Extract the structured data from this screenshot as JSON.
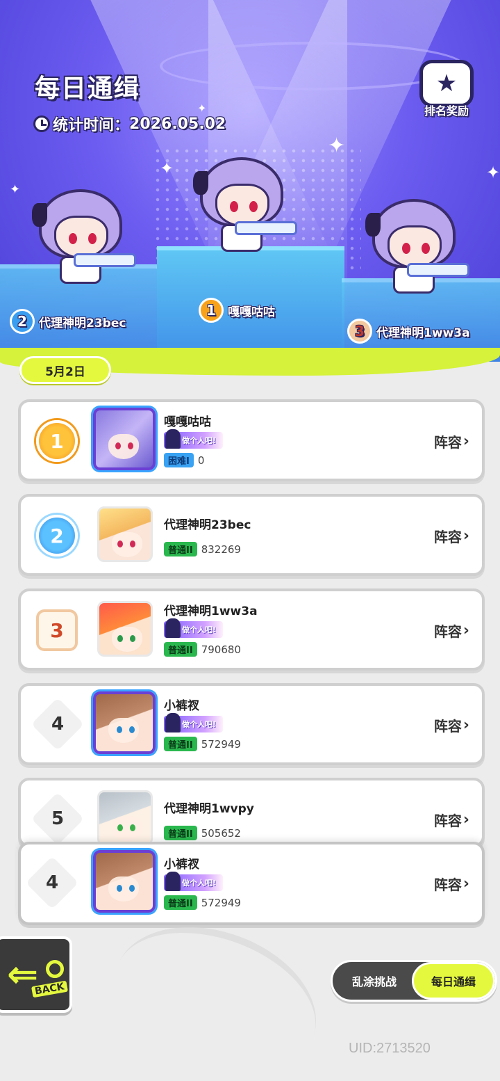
{
  "header": {
    "title": "每日通缉",
    "stat_time_label": "统计时间：",
    "stat_time_value": "2026.05.02",
    "reward_label": "排名奖励"
  },
  "podium": [
    {
      "rank": "2",
      "name": "代理神明23bec"
    },
    {
      "rank": "1",
      "name": "嘎嘎咕咕"
    },
    {
      "rank": "3",
      "name": "代理神明1ww3a"
    }
  ],
  "date_pill": "5月2日",
  "rows": [
    {
      "rank": "1",
      "name": "嘎嘎咕咕",
      "title_badge": "做个人吧!",
      "difficulty": "困难I",
      "score": "0",
      "lineup": "阵容"
    },
    {
      "rank": "2",
      "name": "代理神明23bec",
      "title_badge": "",
      "difficulty": "普通II",
      "score": "832269",
      "lineup": "阵容"
    },
    {
      "rank": "3",
      "name": "代理神明1ww3a",
      "title_badge": "做个人吧!",
      "difficulty": "普通II",
      "score": "790680",
      "lineup": "阵容"
    },
    {
      "rank": "4",
      "name": "小裤衩",
      "title_badge": "做个人吧!",
      "difficulty": "普通II",
      "score": "572949",
      "lineup": "阵容"
    },
    {
      "rank": "5",
      "name": "代理神明1wvpy",
      "title_badge": "",
      "difficulty": "普通II",
      "score": "505652",
      "lineup": "阵容"
    }
  ],
  "my_row": {
    "rank": "4",
    "name": "小裤衩",
    "title_badge": "做个人吧!",
    "difficulty": "普通II",
    "score": "572949",
    "lineup": "阵容"
  },
  "bottom": {
    "back_label": "BACK",
    "tab_left": "乱涂挑战",
    "tab_right": "每日通缉",
    "uid": "UID:2713520"
  },
  "colors": {
    "accent_lime": "#e4f83e",
    "stage_purple": "#6c5cf0"
  }
}
